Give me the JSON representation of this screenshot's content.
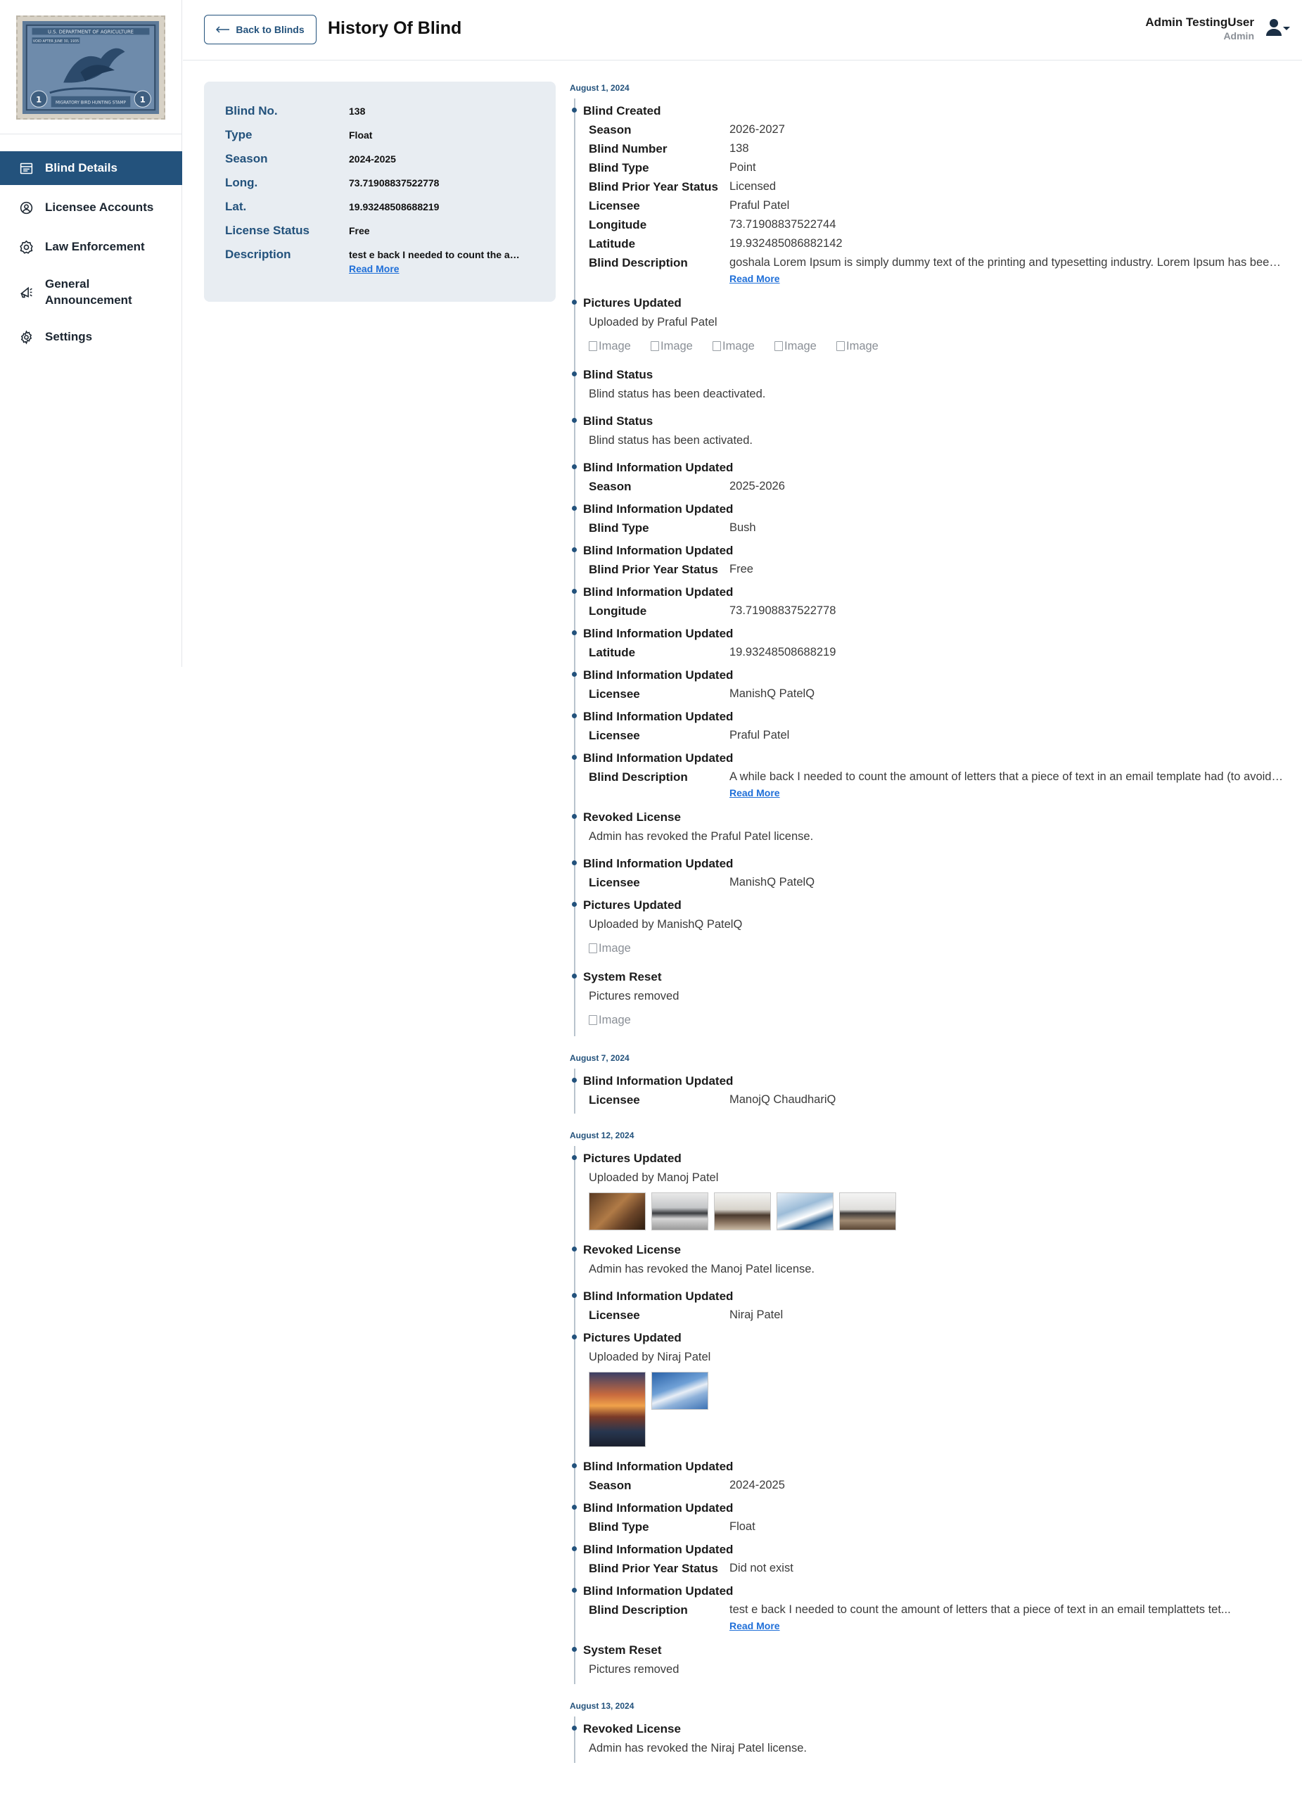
{
  "sidebar": {
    "logo_alt": "U.S. Department of Agriculture Migratory Bird Hunting Stamp",
    "logo_text_top": "U.S. DEPARTMENT OF AGRICULTURE",
    "logo_text_mid": "VOID AFTER JUNE 30, 1935",
    "logo_text_bottom": "MIGRATORY BIRD HUNTING STAMP",
    "logo_denomination": "1",
    "items": [
      {
        "label": "Blind Details",
        "icon": "blind-details-icon",
        "active": true
      },
      {
        "label": "Licensee Accounts",
        "icon": "user-circle-icon",
        "active": false
      },
      {
        "label": "Law Enforcement",
        "icon": "badge-icon",
        "active": false
      },
      {
        "label": "General Announcement",
        "icon": "megaphone-icon",
        "active": false
      },
      {
        "label": "Settings",
        "icon": "gear-icon",
        "active": false
      }
    ]
  },
  "header": {
    "back_label": "Back to Blinds",
    "title": "History Of Blind",
    "user_name": "Admin TestingUser",
    "user_role": "Admin"
  },
  "card": {
    "rows": [
      {
        "label": "Blind No.",
        "value": "138"
      },
      {
        "label": "Type",
        "value": "Float"
      },
      {
        "label": "Season",
        "value": "2024-2025"
      },
      {
        "label": "Long.",
        "value": "73.71908837522778"
      },
      {
        "label": "Lat.",
        "value": "19.93248508688219"
      },
      {
        "label": "License Status",
        "value": "Free"
      },
      {
        "label": "Description",
        "value": "test e back I needed to count the amount of letters that a piece of text in an email templattets tet..."
      }
    ],
    "read_more": "Read More"
  },
  "timeline": {
    "read_more": "Read More",
    "image_alt": "Image",
    "groups": [
      {
        "date": "August 1, 2024"
      },
      {
        "date": "August 7, 2024"
      },
      {
        "date": "August 12, 2024"
      },
      {
        "date": "August 13, 2024"
      }
    ],
    "g1": {
      "e1": {
        "title": "Blind Created",
        "rows": [
          {
            "k": "Season",
            "v": "2026-2027"
          },
          {
            "k": "Blind Number",
            "v": "138"
          },
          {
            "k": "Blind Type",
            "v": "Point"
          },
          {
            "k": "Blind Prior Year Status",
            "v": "Licensed"
          },
          {
            "k": "Licensee",
            "v": "Praful Patel"
          },
          {
            "k": "Longitude",
            "v": "73.71908837522744"
          },
          {
            "k": "Latitude",
            "v": "19.932485086882142"
          },
          {
            "k": "Blind Description",
            "v": "goshala Lorem Ipsum is simply dummy text of the printing and typesetting industry. Lorem Ipsum has been the industry's standard dummy text ever since"
          }
        ]
      },
      "e2": {
        "title": "Pictures Updated",
        "text": "Uploaded by Praful Patel"
      },
      "e3": {
        "title": "Blind Status",
        "text": "Blind status has been deactivated."
      },
      "e4": {
        "title": "Blind Status",
        "text": "Blind status has been activated."
      },
      "u1": {
        "title": "Blind Information Updated",
        "k": "Season",
        "v": "2025-2026"
      },
      "u2": {
        "title": "Blind Information Updated",
        "k": "Blind Type",
        "v": "Bush"
      },
      "u3": {
        "title": "Blind Information Updated",
        "k": "Blind Prior Year Status",
        "v": "Free"
      },
      "u4": {
        "title": "Blind Information Updated",
        "k": "Longitude",
        "v": "73.71908837522778"
      },
      "u5": {
        "title": "Blind Information Updated",
        "k": "Latitude",
        "v": "19.93248508688219"
      },
      "u6": {
        "title": "Blind Information Updated",
        "k": "Licensee",
        "v": "ManishQ PatelQ"
      },
      "u7": {
        "title": "Blind Information Updated",
        "k": "Licensee",
        "v": "Praful Patel"
      },
      "u8": {
        "title": "Blind Information Updated",
        "k": "Blind Description",
        "v": "A while back I needed to count the amount of letters that a piece of text in an email template had (to avoid passing any character limits)"
      },
      "r1": {
        "title": "Revoked License",
        "text": "Admin has revoked the Praful Patel license."
      },
      "u9": {
        "title": "Blind Information Updated",
        "k": "Licensee",
        "v": "ManishQ PatelQ"
      },
      "p2": {
        "title": "Pictures Updated",
        "text": "Uploaded by ManishQ PatelQ"
      },
      "s1": {
        "title": "System Reset",
        "text": "Pictures removed"
      }
    },
    "g2": {
      "u1": {
        "title": "Blind Information Updated",
        "k": "Licensee",
        "v": "ManojQ ChaudhariQ"
      }
    },
    "g3": {
      "p1": {
        "title": "Pictures Updated",
        "text": "Uploaded by Manoj Patel"
      },
      "r1": {
        "title": "Revoked License",
        "text": "Admin has revoked the Manoj Patel license."
      },
      "u1": {
        "title": "Blind Information Updated",
        "k": "Licensee",
        "v": "Niraj Patel"
      },
      "p2": {
        "title": "Pictures Updated",
        "text": "Uploaded by Niraj Patel"
      },
      "u2": {
        "title": "Blind Information Updated",
        "k": "Season",
        "v": "2024-2025"
      },
      "u3": {
        "title": "Blind Information Updated",
        "k": "Blind Type",
        "v": "Float"
      },
      "u4": {
        "title": "Blind Information Updated",
        "k": "Blind Prior Year Status",
        "v": "Did not exist"
      },
      "u5": {
        "title": "Blind Information Updated",
        "k": "Blind Description",
        "v": "test e back I needed to count the amount of letters that a piece of text in an email templattets tet..."
      },
      "s1": {
        "title": "System Reset",
        "text": "Pictures removed"
      }
    },
    "g4": {
      "r1": {
        "title": "Revoked License",
        "text": "Admin has revoked the Niraj Patel license."
      }
    }
  },
  "colors": {
    "primary": "#23527c",
    "card_bg": "#e8edf2",
    "link": "#1f6fd8"
  }
}
